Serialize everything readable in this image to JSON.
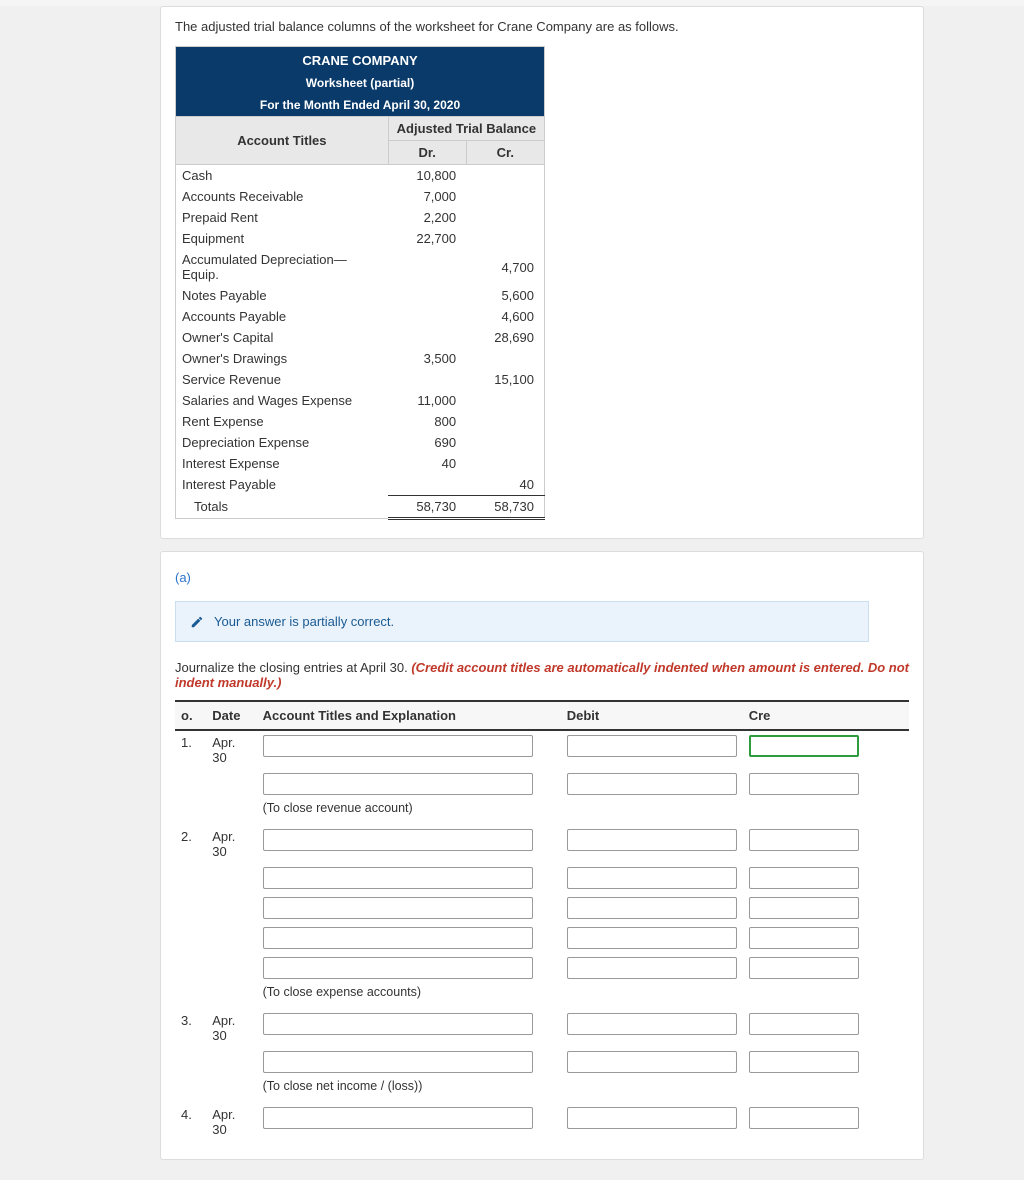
{
  "intro": "The adjusted trial balance columns of the worksheet for Crane Company are as follows.",
  "header": {
    "company": "CRANE COMPANY",
    "report": "Worksheet (partial)",
    "period": "For the Month Ended April 30, 2020"
  },
  "colheads": {
    "atb": "Adjusted Trial Balance",
    "acct": "Account Titles",
    "dr": "Dr.",
    "cr": "Cr."
  },
  "rows": [
    {
      "acct": "Cash",
      "dr": "10,800",
      "cr": ""
    },
    {
      "acct": "Accounts Receivable",
      "dr": "7,000",
      "cr": ""
    },
    {
      "acct": "Prepaid Rent",
      "dr": "2,200",
      "cr": ""
    },
    {
      "acct": "Equipment",
      "dr": "22,700",
      "cr": ""
    },
    {
      "acct": "Accumulated Depreciation—Equip.",
      "dr": "",
      "cr": "4,700"
    },
    {
      "acct": "Notes Payable",
      "dr": "",
      "cr": "5,600"
    },
    {
      "acct": "Accounts Payable",
      "dr": "",
      "cr": "4,600"
    },
    {
      "acct": "Owner's Capital",
      "dr": "",
      "cr": "28,690"
    },
    {
      "acct": "Owner's Drawings",
      "dr": "3,500",
      "cr": ""
    },
    {
      "acct": "Service Revenue",
      "dr": "",
      "cr": "15,100"
    },
    {
      "acct": "Salaries and Wages Expense",
      "dr": "11,000",
      "cr": ""
    },
    {
      "acct": "Rent Expense",
      "dr": "800",
      "cr": ""
    },
    {
      "acct": "Depreciation Expense",
      "dr": "690",
      "cr": ""
    },
    {
      "acct": "Interest Expense",
      "dr": "40",
      "cr": ""
    },
    {
      "acct": "Interest Payable",
      "dr": "",
      "cr": "40"
    }
  ],
  "totals": {
    "label": "Totals",
    "dr": "58,730",
    "cr": "58,730"
  },
  "part_label": "(a)",
  "feedback": "Your answer is partially correct.",
  "journal_instr_plain": "Journalize the closing entries at April 30. ",
  "journal_instr_red": "(Credit account titles are automatically indented when amount is entered. Do not indent manually.)",
  "jr_head": {
    "no": "o.",
    "date": "Date",
    "acct": "Account Titles and Explanation",
    "debit": "Debit",
    "credit": "Cre"
  },
  "entries": [
    {
      "no": "1.",
      "date": "Apr. 30",
      "lines": 2,
      "caption": "(To close revenue account)",
      "first_credit_ok": true
    },
    {
      "no": "2.",
      "date": "Apr. 30",
      "lines": 5,
      "caption": "(To close expense accounts)"
    },
    {
      "no": "3.",
      "date": "Apr. 30",
      "lines": 2,
      "caption": "(To close net income / (loss))"
    },
    {
      "no": "4.",
      "date": "Apr. 30",
      "lines": 1,
      "caption": ""
    }
  ],
  "chart_data": {
    "type": "table",
    "title": "Adjusted Trial Balance — Crane Company — Month Ended April 30, 2020",
    "columns": [
      "Account",
      "Dr",
      "Cr"
    ],
    "rows": [
      [
        "Cash",
        10800,
        null
      ],
      [
        "Accounts Receivable",
        7000,
        null
      ],
      [
        "Prepaid Rent",
        2200,
        null
      ],
      [
        "Equipment",
        22700,
        null
      ],
      [
        "Accumulated Depreciation—Equip.",
        null,
        4700
      ],
      [
        "Notes Payable",
        null,
        5600
      ],
      [
        "Accounts Payable",
        null,
        4600
      ],
      [
        "Owner's Capital",
        null,
        28690
      ],
      [
        "Owner's Drawings",
        3500,
        null
      ],
      [
        "Service Revenue",
        null,
        15100
      ],
      [
        "Salaries and Wages Expense",
        11000,
        null
      ],
      [
        "Rent Expense",
        800,
        null
      ],
      [
        "Depreciation Expense",
        690,
        null
      ],
      [
        "Interest Expense",
        40,
        null
      ],
      [
        "Interest Payable",
        null,
        40
      ]
    ],
    "totals": {
      "Dr": 58730,
      "Cr": 58730
    }
  }
}
